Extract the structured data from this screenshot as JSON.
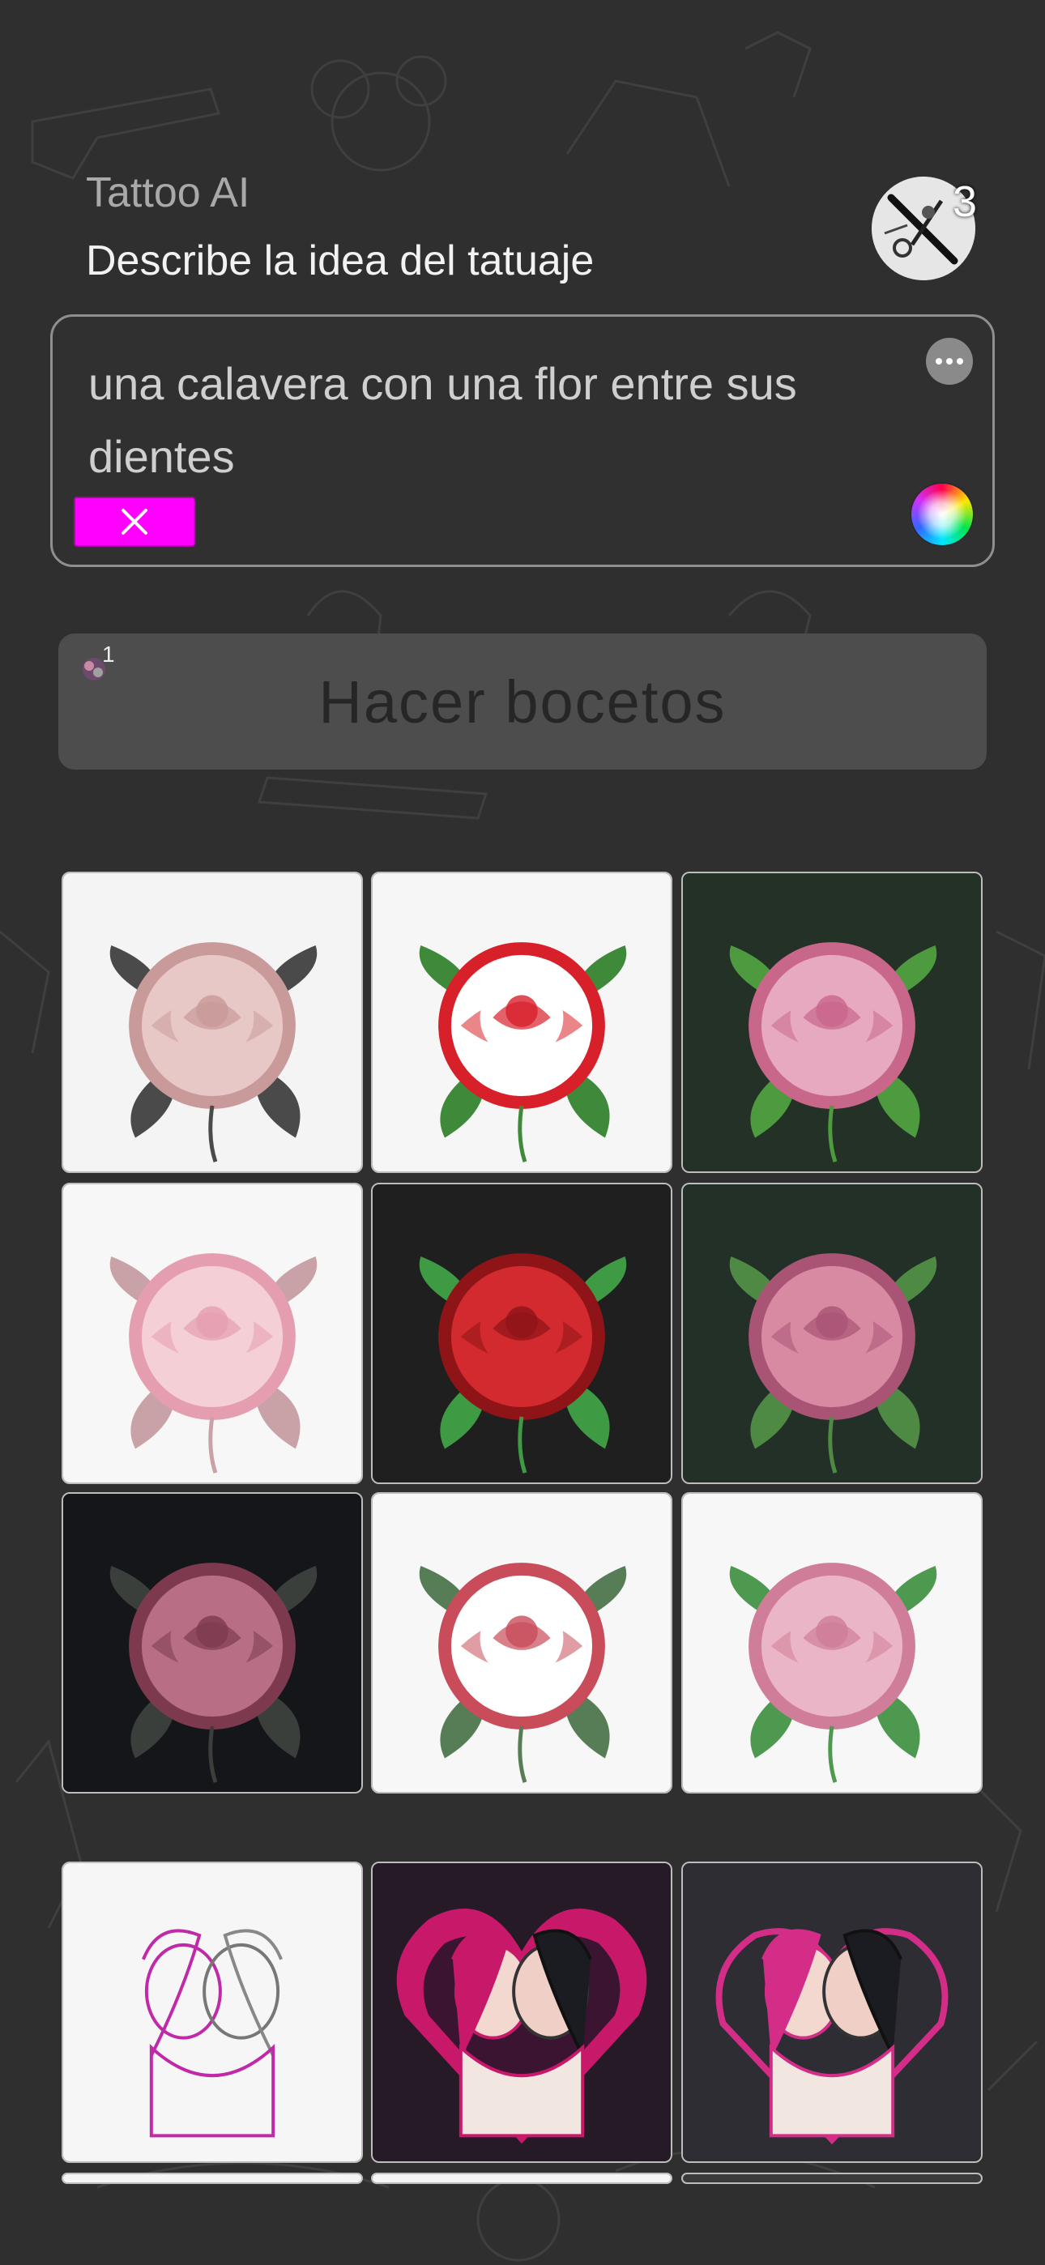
{
  "app": {
    "title": "Tattoo AI",
    "subtitle": "Describe la idea del tatuaje",
    "credits": "3"
  },
  "prompt": {
    "text": "una calavera con una flor entre sus dientes"
  },
  "actions": {
    "sketch_label": "Hacer bocetos",
    "sketch_count": "1"
  },
  "gallery": {
    "rows": [
      [
        {
          "bg": "#f4f4f4",
          "petal": "#e8c7c7",
          "petal2": "#c99a9a",
          "leaf": "#4a4a4a"
        },
        {
          "bg": "#f6f6f6",
          "petal": "#ffffff",
          "petal2": "#d8202a",
          "leaf": "#3f8a3a"
        },
        {
          "bg": "#233127",
          "petal": "#e7a9c0",
          "petal2": "#c9678b",
          "leaf": "#4e9a3e"
        }
      ],
      [
        {
          "bg": "#f7f7f7",
          "petal": "#f4cfd6",
          "petal2": "#e59eb0",
          "leaf": "#c9a2a8"
        },
        {
          "bg": "#1f1f1f",
          "petal": "#d22a2e",
          "petal2": "#8e1418",
          "leaf": "#3f9a44"
        },
        {
          "bg": "#223027",
          "petal": "#d78aa2",
          "petal2": "#a95474",
          "leaf": "#4f8a44"
        }
      ],
      [
        {
          "bg": "#15161a",
          "petal": "#b86f86",
          "petal2": "#7d3a4f",
          "leaf": "#3a3f3c"
        },
        {
          "bg": "#f7f7f7",
          "petal": "#ffffff",
          "petal2": "#c84c5a",
          "leaf": "#577d57"
        },
        {
          "bg": "#f7f7f7",
          "petal": "#ebb5c8",
          "petal2": "#cf7d98",
          "leaf": "#4e9950"
        }
      ],
      [
        {
          "bg": "#f6f6f6",
          "kind": "couple",
          "accent": "#c02aa8"
        },
        {
          "bg": "#251a26",
          "kind": "heart",
          "accent": "#c8186a"
        },
        {
          "bg": "#2e2d33",
          "kind": "couple-dark",
          "accent": "#d42d88"
        }
      ]
    ]
  },
  "colors": {
    "background": "#2f2f2f",
    "clear_button": "#ff00ff"
  }
}
